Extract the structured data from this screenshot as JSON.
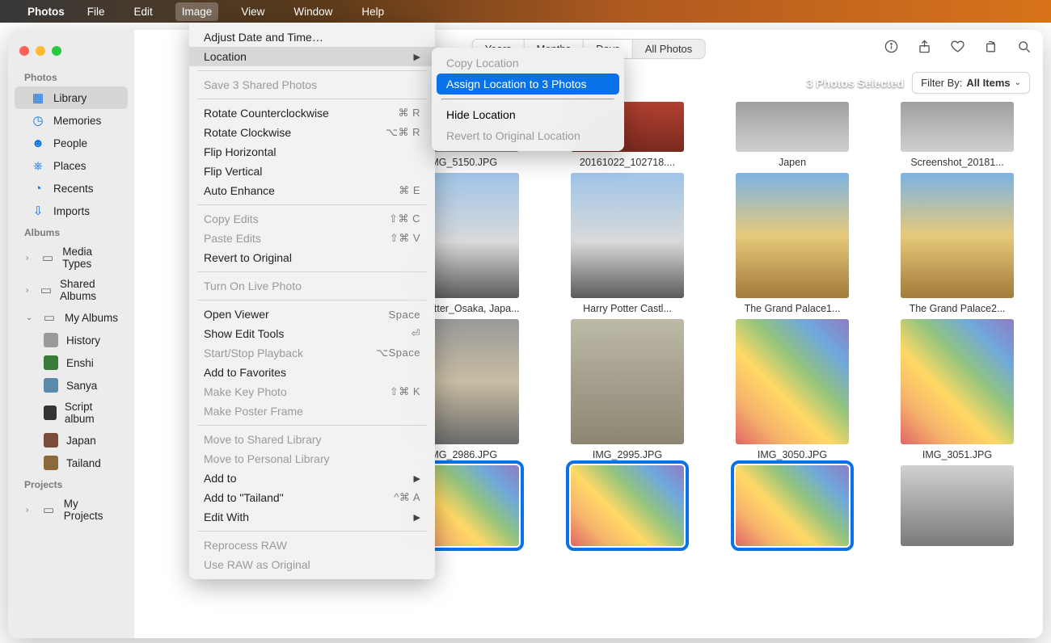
{
  "menubar": {
    "app": "Photos",
    "items": [
      "File",
      "Edit",
      "Image",
      "View",
      "Window",
      "Help"
    ],
    "active": "Image"
  },
  "image_menu": {
    "adjust_date": "Adjust Date and Time…",
    "location": "Location",
    "save_shared": "Save 3 Shared Photos",
    "rot_ccw": "Rotate Counterclockwise",
    "rot_ccw_sc": "⌘ R",
    "rot_cw": "Rotate Clockwise",
    "rot_cw_sc": "⌥⌘ R",
    "flip_h": "Flip Horizontal",
    "flip_v": "Flip Vertical",
    "auto_enh": "Auto Enhance",
    "auto_enh_sc": "⌘ E",
    "copy_edits": "Copy Edits",
    "copy_edits_sc": "⇧⌘ C",
    "paste_edits": "Paste Edits",
    "paste_edits_sc": "⇧⌘ V",
    "revert": "Revert to Original",
    "live_photo": "Turn On Live Photo",
    "open_viewer": "Open Viewer",
    "open_viewer_sc": "Space",
    "show_edit": "Show Edit Tools",
    "show_edit_sc": "⏎",
    "playback": "Start/Stop Playback",
    "playback_sc": "⌥Space",
    "add_fav": "Add to Favorites",
    "make_key": "Make Key Photo",
    "make_key_sc": "⇧⌘ K",
    "make_poster": "Make Poster Frame",
    "move_shared": "Move to Shared Library",
    "move_personal": "Move to Personal Library",
    "add_to": "Add to",
    "add_tailand": "Add to \"Tailand\"",
    "add_tailand_sc": "^⌘ A",
    "edit_with": "Edit With",
    "reprocess": "Reprocess RAW",
    "use_raw": "Use RAW as Original"
  },
  "location_submenu": {
    "copy": "Copy Location",
    "assign": "Assign Location to 3 Photos",
    "hide": "Hide Location",
    "revert": "Revert to Original Location"
  },
  "sidebar": {
    "photos_header": "Photos",
    "library": "Library",
    "memories": "Memories",
    "people": "People",
    "places": "Places",
    "recents": "Recents",
    "imports": "Imports",
    "albums_header": "Albums",
    "media_types": "Media Types",
    "shared_albums": "Shared Albums",
    "my_albums": "My Albums",
    "albums": [
      "History",
      "Enshi",
      "Sanya",
      "Script album",
      "Japan",
      "Tailand"
    ],
    "projects_header": "Projects",
    "my_projects": "My Projects"
  },
  "toolbar": {
    "segments": [
      "Years",
      "Months",
      "Days",
      "All Photos"
    ],
    "active": "All Photos"
  },
  "subbar": {
    "selected": "3 Photos Selected",
    "filter_label": "Filter By:",
    "filter_value": "All Items"
  },
  "photos_row1": [
    {
      "cap": "IMG_5150.JPG",
      "cls": "p-sky"
    },
    {
      "cap": "20161022_102718....",
      "cls": "p-red"
    },
    {
      "cap": "Japen",
      "cls": "p-street"
    },
    {
      "cap": "Screenshot_20181...",
      "cls": "p-street"
    }
  ],
  "photos_row2": [
    {
      "cap": "...y Potter_Osaka, Japa...",
      "cls": "p-castle"
    },
    {
      "cap": "Harry Potter Castl...",
      "cls": "p-castle"
    },
    {
      "cap": "The Grand Palace1...",
      "cls": "p-temple"
    },
    {
      "cap": "The Grand Palace2...",
      "cls": "p-temple"
    }
  ],
  "photos_row3": [
    {
      "cap": "IMG_2986.JPG",
      "cls": "p-tiger"
    },
    {
      "cap": "IMG_2995.JPG",
      "cls": "p-croc"
    },
    {
      "cap": "IMG_3050.JPG",
      "cls": "p-shop"
    },
    {
      "cap": "IMG_3051.JPG",
      "cls": "p-shop"
    }
  ],
  "photos_row4": [
    {
      "cap": "",
      "cls": "p-shop",
      "sel": true
    },
    {
      "cap": "",
      "cls": "p-shop",
      "sel": true
    },
    {
      "cap": "",
      "cls": "p-shop",
      "sel": true
    },
    {
      "cap": "",
      "cls": "p-bldg"
    }
  ]
}
